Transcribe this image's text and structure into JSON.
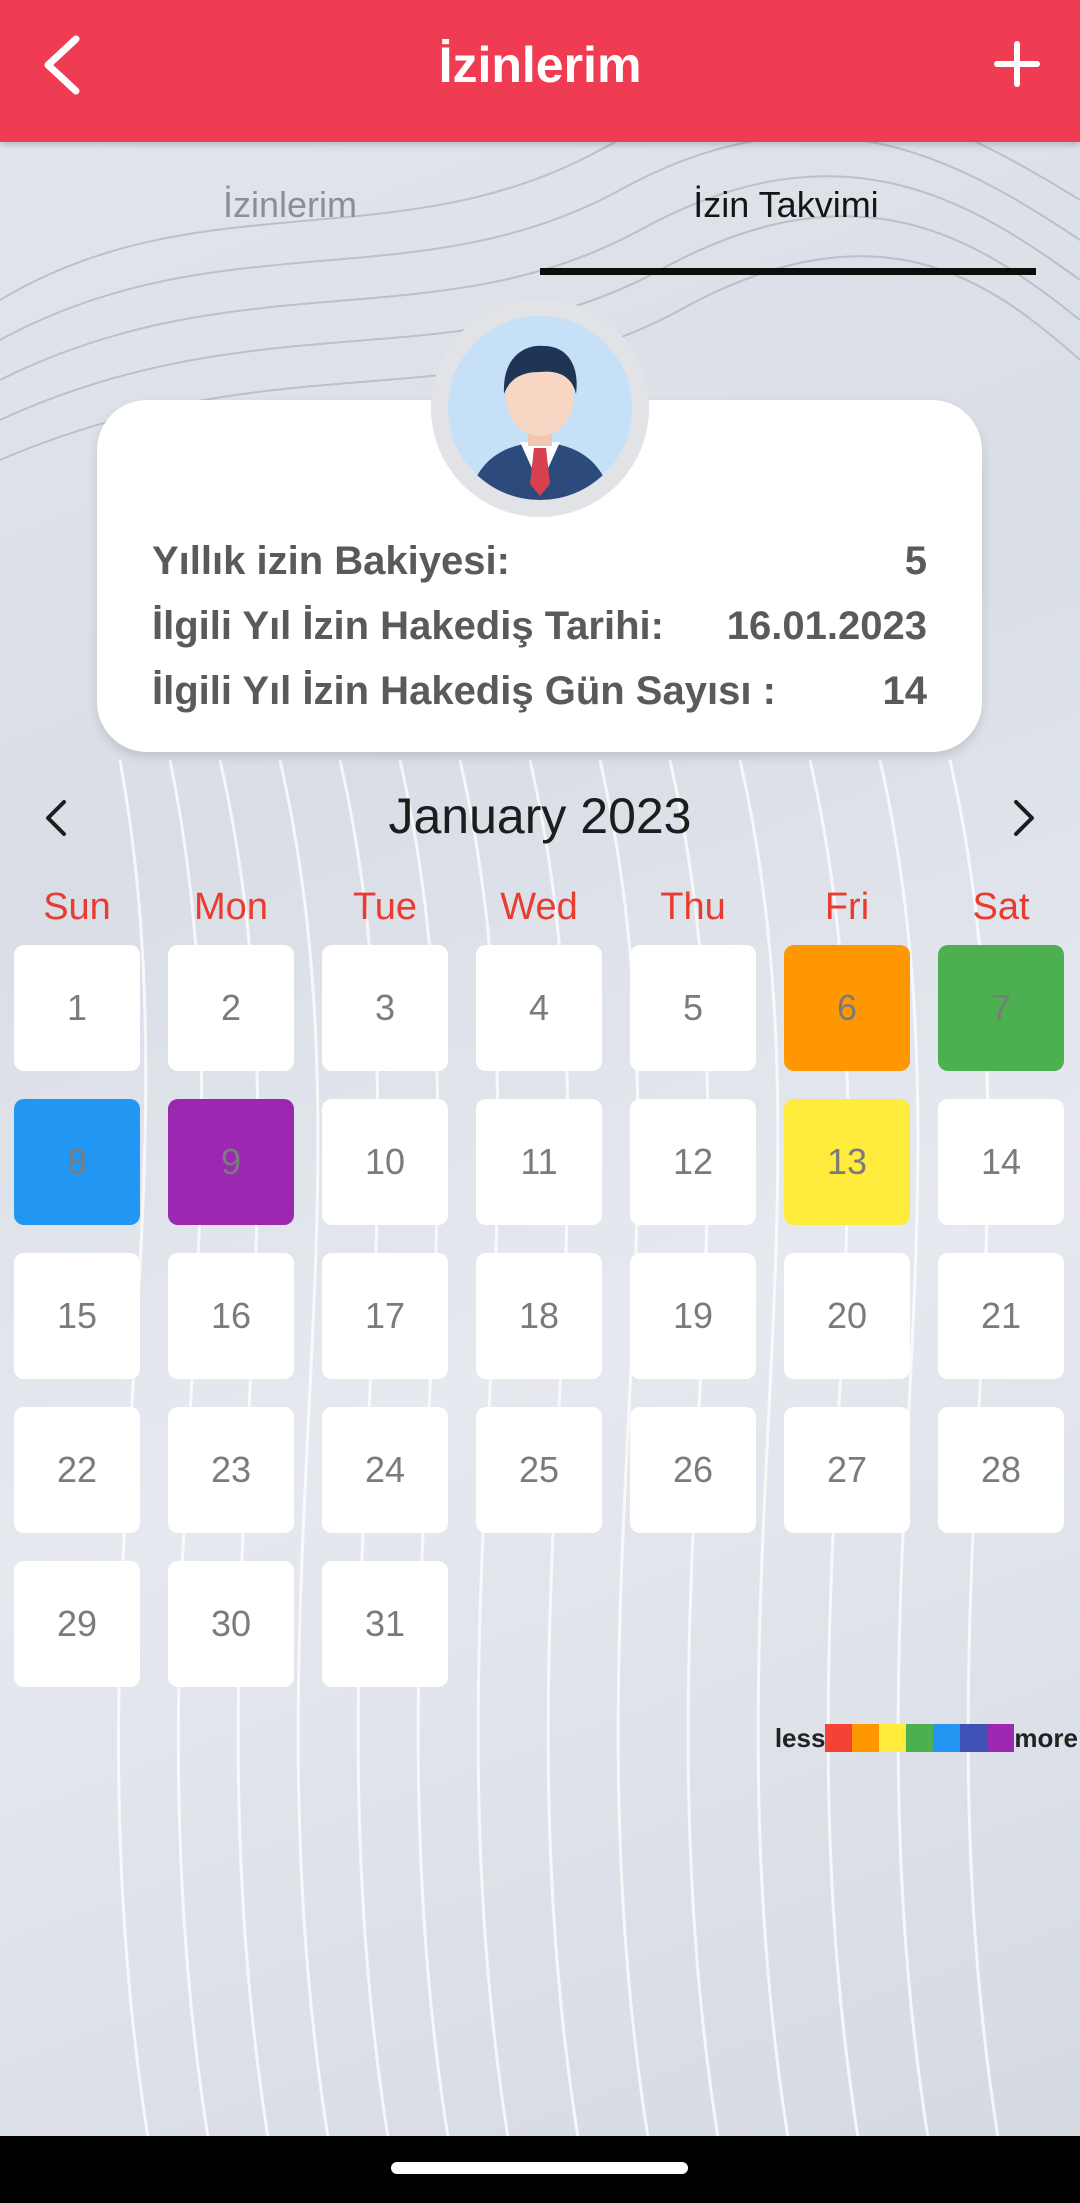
{
  "appbar": {
    "title": "İzinlerim",
    "back_icon": "arrow-back-icon",
    "add_icon": "plus-icon",
    "color": "#f03c53"
  },
  "tabs": [
    {
      "label": "İzinlerim",
      "selected": false
    },
    {
      "label": "İzin Takvimi",
      "selected": true
    }
  ],
  "profile": {
    "avatar_icon": "businessman-avatar-icon",
    "rows": [
      {
        "label": "Yıllık izin Bakiyesi:",
        "value": "5"
      },
      {
        "label": "İlgili Yıl İzin Hakediş Tarihi:",
        "value": "16.01.2023"
      },
      {
        "label": "İlgili Yıl İzin Hakediş Gün Sayısı :",
        "value": "14"
      }
    ]
  },
  "calendar": {
    "month_title": "January 2023",
    "prev_icon": "chevron-left-icon",
    "next_icon": "chevron-right-icon",
    "weekdays": [
      "Sun",
      "Mon",
      "Tue",
      "Wed",
      "Thu",
      "Fri",
      "Sat"
    ],
    "first_weekday_index": 0,
    "days": [
      "1",
      "2",
      "3",
      "4",
      "5",
      "6",
      "7",
      "8",
      "9",
      "10",
      "11",
      "12",
      "13",
      "14",
      "15",
      "16",
      "17",
      "18",
      "19",
      "20",
      "21",
      "22",
      "23",
      "24",
      "25",
      "26",
      "27",
      "28",
      "29",
      "30",
      "31"
    ],
    "highlighted": {
      "6": "#ff9800",
      "7": "#4caf50",
      "8": "#2196f3",
      "9": "#9c27b0",
      "13": "#ffeb3b"
    }
  },
  "legend": {
    "less_label": "less",
    "more_label": "more",
    "colors": [
      "#f44336",
      "#ff9800",
      "#ffeb3b",
      "#4caf50",
      "#2196f3",
      "#3f51b5",
      "#9c27b0"
    ]
  }
}
